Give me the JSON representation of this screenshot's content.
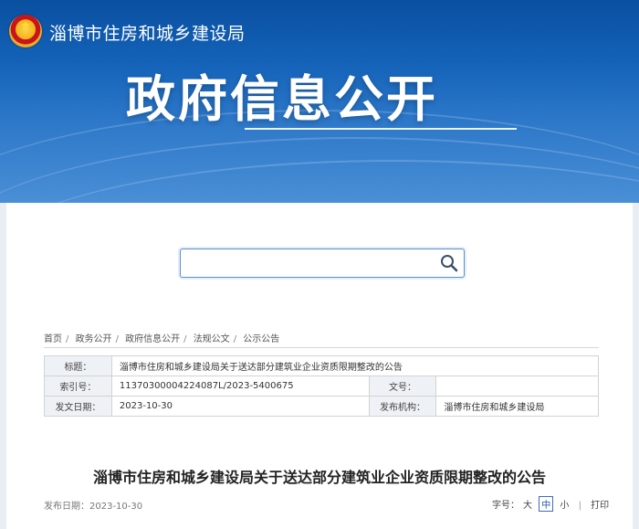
{
  "header": {
    "site_name": "淄博市住房和城乡建设局",
    "banner_title": "政府信息公开"
  },
  "search": {
    "placeholder": "",
    "value": ""
  },
  "breadcrumb": [
    "首页",
    "政务公开",
    "政府信息公开",
    "法规公文",
    "公示公告"
  ],
  "meta": {
    "title_label": "标题：",
    "title_value": "淄博市住房和城乡建设局关于送达部分建筑业企业资质限期整改的公告",
    "index_label": "索引号：",
    "index_value": "11370300004224087L/2023-5400675",
    "docno_label": "文号：",
    "docno_value": "",
    "date_label": "发文日期：",
    "date_value": "2023-10-30",
    "org_label": "发布机构：",
    "org_value": "淄博市住房和城乡建设局"
  },
  "article": {
    "title": "淄博市住房和城乡建设局关于送达部分建筑业企业资质限期整改的公告",
    "publish_date": "发布日期：2023-10-30"
  },
  "tools": {
    "font_label": "字号：",
    "large": "大",
    "medium": "中",
    "small": "小",
    "print": "打印"
  },
  "colors": {
    "banner": "#1362b8",
    "accent": "#1f57a8"
  }
}
